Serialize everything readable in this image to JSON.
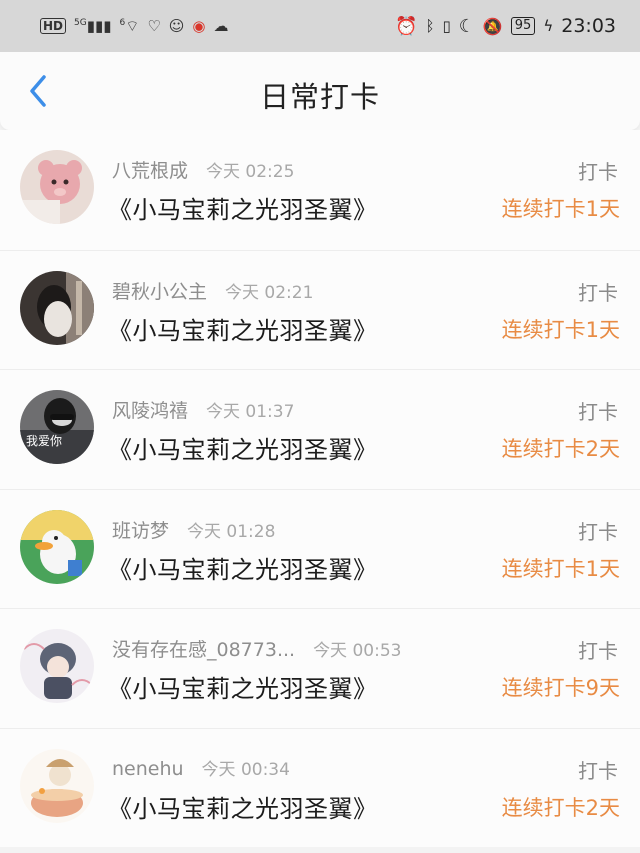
{
  "status_bar": {
    "hd": "HD",
    "net1": "5G",
    "net2": "6",
    "battery": "95",
    "time": "23:03"
  },
  "header": {
    "title": "日常打卡"
  },
  "entries": [
    {
      "name": "八荒根成",
      "time": "今天 02:25",
      "book": "《小马宝莉之光羽圣翼》",
      "action": "打卡",
      "streak": "连续打卡1天"
    },
    {
      "name": "碧秋小公主",
      "time": "今天 02:21",
      "book": "《小马宝莉之光羽圣翼》",
      "action": "打卡",
      "streak": "连续打卡1天"
    },
    {
      "name": "风陵鸿禧",
      "time": "今天 01:37",
      "book": "《小马宝莉之光羽圣翼》",
      "action": "打卡",
      "streak": "连续打卡2天",
      "avatar_text": "我爱你"
    },
    {
      "name": "班访梦",
      "time": "今天 01:28",
      "book": "《小马宝莉之光羽圣翼》",
      "action": "打卡",
      "streak": "连续打卡1天"
    },
    {
      "name": "没有存在感_08773...",
      "time": "今天 00:53",
      "book": "《小马宝莉之光羽圣翼》",
      "action": "打卡",
      "streak": "连续打卡9天"
    },
    {
      "name": "nenehu",
      "time": "今天 00:34",
      "book": "《小马宝莉之光羽圣翼》",
      "action": "打卡",
      "streak": "连续打卡2天"
    }
  ],
  "colors": {
    "accent_blue": "#3d8ee8",
    "streak_orange": "#e88b44"
  }
}
